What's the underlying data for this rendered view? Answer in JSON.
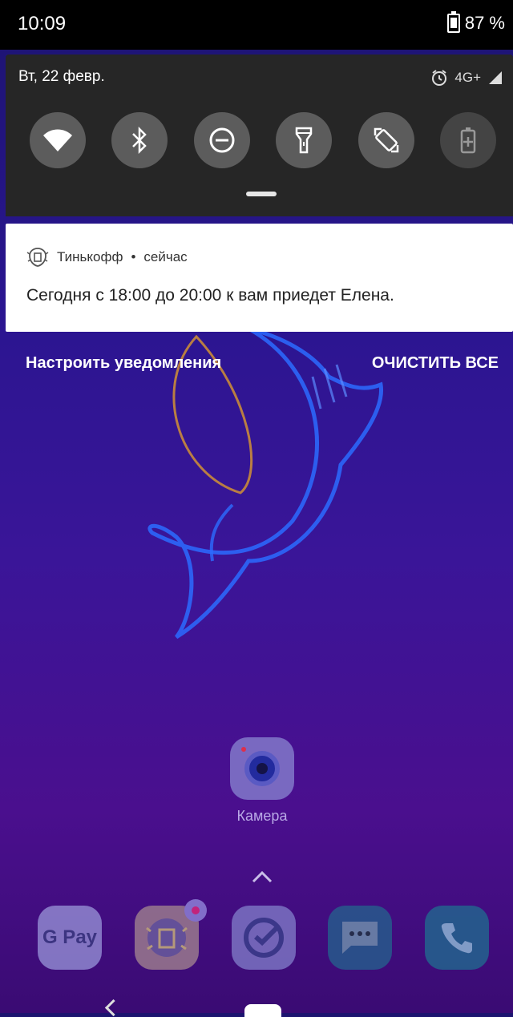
{
  "status_bar": {
    "time": "10:09",
    "battery_percent": "87 %"
  },
  "quick_settings": {
    "date": "Вт, 22 февр.",
    "network_type": "4G+",
    "tiles": [
      {
        "name": "wifi",
        "icon": "wifi-icon",
        "active": true
      },
      {
        "name": "bluetooth",
        "icon": "bluetooth-icon",
        "active": true
      },
      {
        "name": "do-not-disturb",
        "icon": "do-not-disturb-icon",
        "active": true
      },
      {
        "name": "flashlight",
        "icon": "flashlight-icon",
        "active": true
      },
      {
        "name": "auto-rotate",
        "icon": "auto-rotate-icon",
        "active": true
      },
      {
        "name": "battery-saver",
        "icon": "battery-saver-icon",
        "active": false
      }
    ]
  },
  "notification": {
    "app_name": "Тинькофф",
    "separator": "•",
    "time": "сейчас",
    "text": "Сегодня с 18:00 до 20:00 к вам приедет Елена."
  },
  "notification_actions": {
    "settings_label": "Настроить уведомления",
    "clear_all_label": "ОЧИСТИТЬ ВСЕ"
  },
  "home": {
    "camera_label": "Камера",
    "dock": [
      {
        "name": "google-pay",
        "label": "G Pay"
      },
      {
        "name": "tinkoff"
      },
      {
        "name": "sberbank"
      },
      {
        "name": "messages"
      },
      {
        "name": "phone"
      }
    ]
  },
  "colors": {
    "qs_background": "#262626",
    "notification_background": "#ffffff",
    "wallpaper_top": "#1c1470",
    "wallpaper_bottom": "#4a0f8e"
  }
}
